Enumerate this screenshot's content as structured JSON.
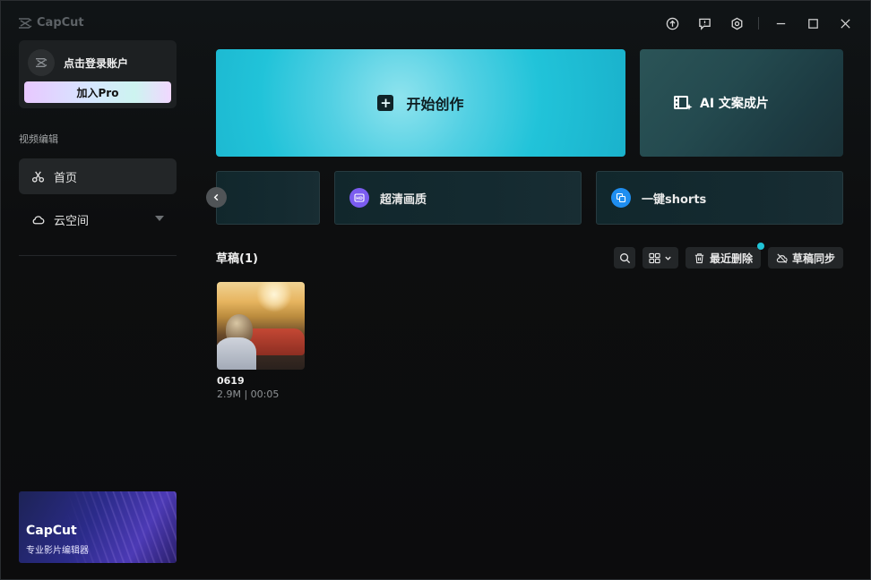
{
  "app": {
    "name": "CapCut"
  },
  "titlebar": {
    "icons": [
      "upload-icon",
      "feedback-icon",
      "settings-icon",
      "minimize-icon",
      "maximize-icon",
      "close-icon"
    ]
  },
  "sidebar": {
    "login_text": "点击登录账户",
    "pro_button": "加入Pro",
    "section_label": "视频编辑",
    "items": [
      {
        "label": "首页",
        "icon": "scissors-icon",
        "active": true
      },
      {
        "label": "云空间",
        "icon": "cloud-icon",
        "active": false
      }
    ],
    "promo": {
      "title": "CapCut",
      "subtitle": "专业影片编辑器"
    }
  },
  "main": {
    "start_label": "开始创作",
    "ai_label": "AI 文案成片",
    "tools": [
      {
        "label": "超清画质",
        "icon": "hd-icon",
        "color": "#7b5cf0"
      },
      {
        "label": "一键shorts",
        "icon": "shorts-icon",
        "color": "#1f8ef0"
      }
    ],
    "drafts": {
      "title": "草稿(1)",
      "recently_deleted": "最近删除",
      "sync": "草稿同步",
      "items": [
        {
          "name": "0619",
          "meta": "2.9M | 00:05"
        }
      ]
    }
  },
  "colors": {
    "accent": "#21c3d9",
    "notification_dot": "#20c4d7"
  }
}
